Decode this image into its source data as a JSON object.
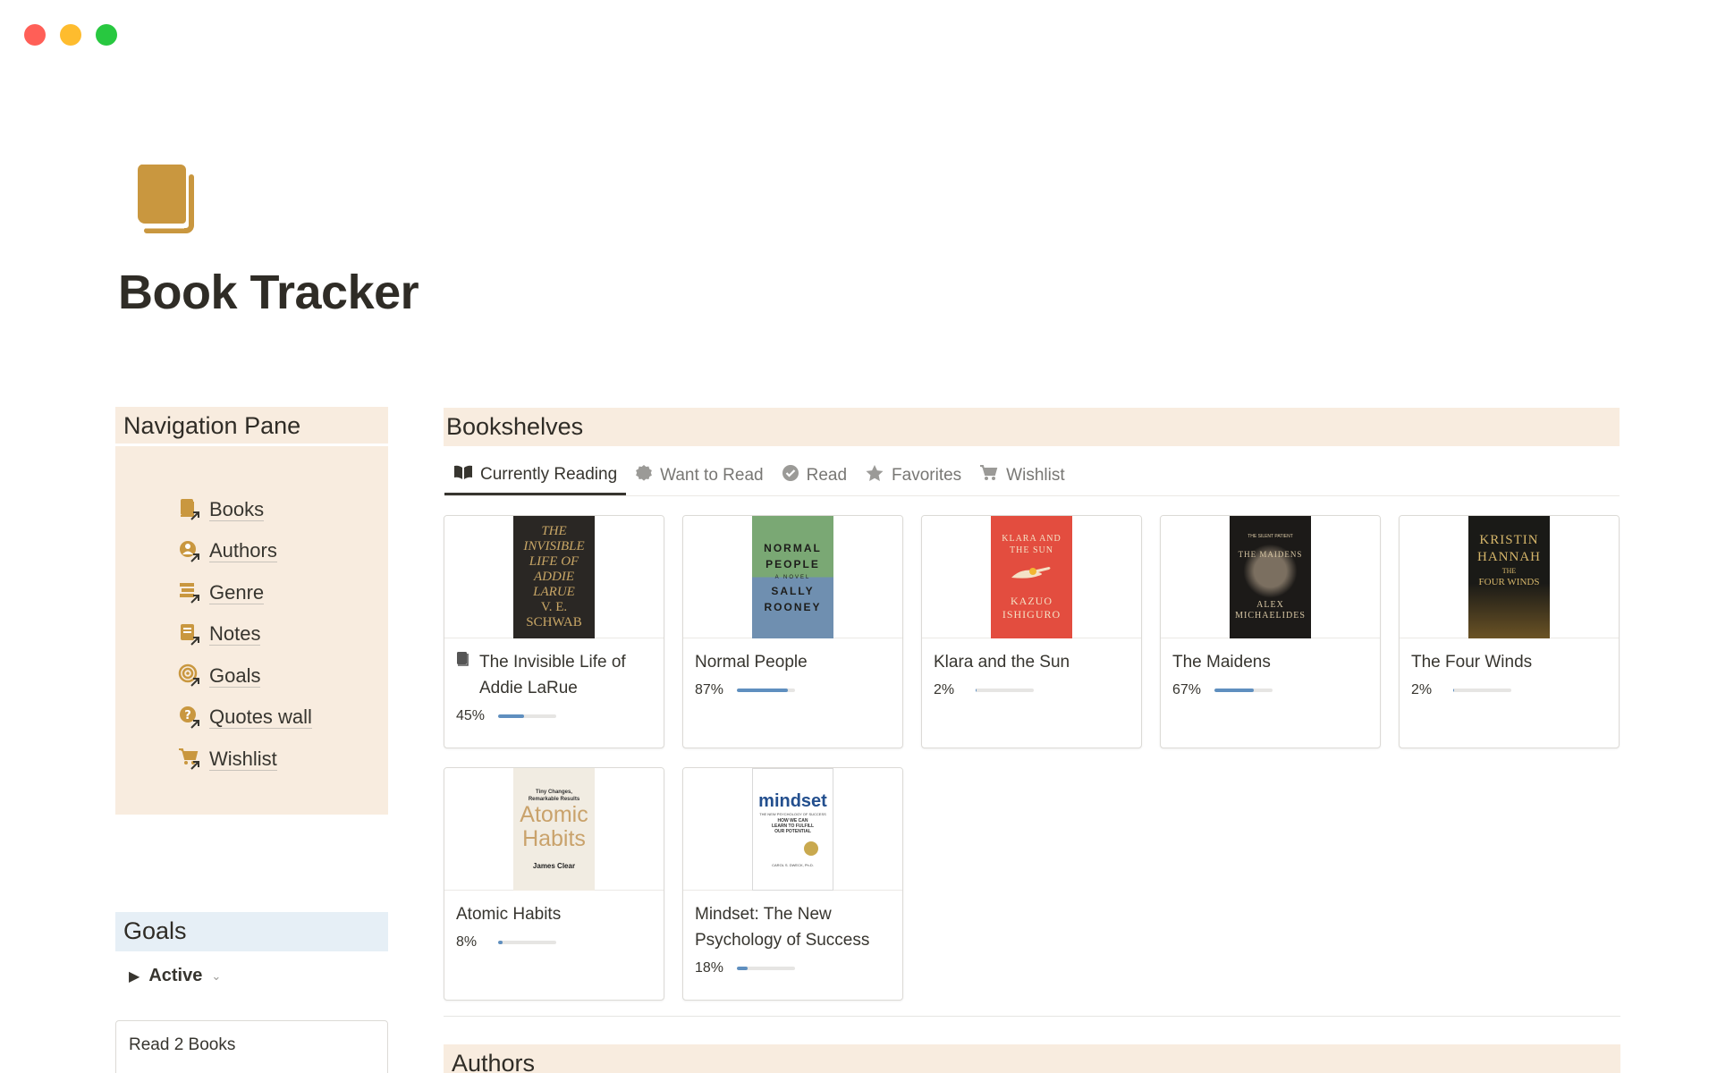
{
  "window": {
    "controls": [
      "close",
      "minimize",
      "zoom"
    ]
  },
  "page": {
    "title": "Book Tracker",
    "icon": "books-icon"
  },
  "navigation": {
    "title": "Navigation Pane",
    "items": [
      {
        "label": "Books",
        "icon": "book-link-icon"
      },
      {
        "label": "Authors",
        "icon": "person-link-icon"
      },
      {
        "label": "Genre",
        "icon": "stack-link-icon"
      },
      {
        "label": "Notes",
        "icon": "note-link-icon"
      },
      {
        "label": "Goals",
        "icon": "target-link-icon"
      },
      {
        "label": "Quotes wall",
        "icon": "quote-link-icon"
      },
      {
        "label": "Wishlist",
        "icon": "cart-link-icon"
      }
    ]
  },
  "goals": {
    "title": "Goals",
    "filter": "Active",
    "cards": [
      {
        "title": "Read 2 Books"
      }
    ]
  },
  "bookshelves": {
    "title": "Bookshelves",
    "tabs": [
      {
        "label": "Currently Reading",
        "icon": "open-book-icon",
        "active": true
      },
      {
        "label": "Want to Read",
        "icon": "badge-icon",
        "active": false
      },
      {
        "label": "Read",
        "icon": "check-circle-icon",
        "active": false
      },
      {
        "label": "Favorites",
        "icon": "star-icon",
        "active": false
      },
      {
        "label": "Wishlist",
        "icon": "cart-icon",
        "active": false
      }
    ],
    "books": [
      {
        "title": "The Invisible Life of Addie LaRue",
        "progress_label": "45%",
        "progress": 0.45,
        "has_page_icon": true,
        "cover": {
          "lines": [
            "THE",
            "INVISIBLE",
            "LIFE OF",
            "ADDIE",
            "LARUE",
            "V. E.",
            "SCHWAB"
          ],
          "bg": "#2a2724",
          "fg": "#c9a766"
        }
      },
      {
        "title": "Normal People",
        "progress_label": "87%",
        "progress": 0.87,
        "has_page_icon": false,
        "cover": {
          "lines": [
            "NORMAL",
            "PEOPLE",
            "A NOVEL",
            "SALLY",
            "ROONEY"
          ],
          "bg": "#6e9c6b",
          "fg": "#1d1d1b"
        }
      },
      {
        "title": "Klara and the Sun",
        "progress_label": "2%",
        "progress": 0.02,
        "has_page_icon": false,
        "cover": {
          "lines": [
            "KLARA AND",
            "THE SUN",
            "KAZUO",
            "ISHIGURO"
          ],
          "bg": "#e34d3f",
          "fg": "#f4e2c6"
        }
      },
      {
        "title": "The Maidens",
        "progress_label": "67%",
        "progress": 0.67,
        "has_page_icon": false,
        "cover": {
          "lines": [
            "THE SILENT PATIENT",
            "THE MAIDENS",
            "ALEX",
            "MICHAELIDES"
          ],
          "bg": "#1c1a18",
          "fg": "#d8c7a4"
        }
      },
      {
        "title": "The Four Winds",
        "progress_label": "2%",
        "progress": 0.02,
        "has_page_icon": false,
        "cover": {
          "lines": [
            "KRISTIN",
            "HANNAH",
            "THE",
            "FOUR WINDS"
          ],
          "bg": "#1a1a17",
          "fg": "#d6b66a"
        }
      },
      {
        "title": "Atomic Habits",
        "progress_label": "8%",
        "progress": 0.08,
        "has_page_icon": false,
        "cover": {
          "lines": [
            "Tiny Changes,",
            "Remarkable Results",
            "Atomic",
            "Habits",
            "James Clear"
          ],
          "bg": "#f1ece2",
          "fg": "#c9a26b"
        }
      },
      {
        "title": "Mindset: The New Psychology of Success",
        "progress_label": "18%",
        "progress": 0.18,
        "has_page_icon": false,
        "cover": {
          "lines": [
            "mindset",
            "THE NEW PSYCHOLOGY OF SUCCESS",
            "HOW WE CAN",
            "LEARN TO FULFILL",
            "OUR POTENTIAL",
            "CAROL S. DWECK, Ph.D."
          ],
          "bg": "#ffffff",
          "fg": "#234f8e"
        }
      }
    ]
  },
  "authors": {
    "title": "Authors"
  },
  "colors": {
    "accent_gold": "#c9973f",
    "section_tan": "#f8ecdf",
    "section_blue": "#e6eff6",
    "progress_blue": "#5f8fbf"
  }
}
